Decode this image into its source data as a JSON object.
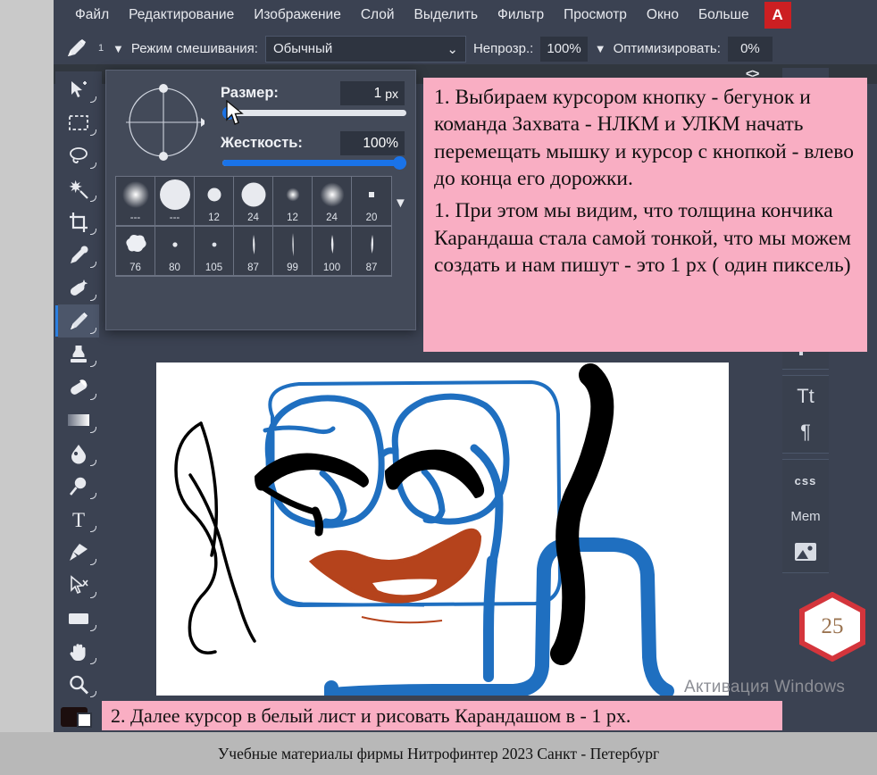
{
  "menubar": {
    "items": [
      {
        "label": "Файл"
      },
      {
        "label": "Редактирование"
      },
      {
        "label": "Изображение"
      },
      {
        "label": "Слой"
      },
      {
        "label": "Выделить"
      },
      {
        "label": "Фильтр"
      },
      {
        "label": "Просмотр"
      },
      {
        "label": "Окно"
      },
      {
        "label": "Больше"
      }
    ],
    "ai_badge": "A",
    "ai_badge_color": "#cc1f22"
  },
  "optionsbar": {
    "tool_icon": "pencil-icon",
    "preset_number": "1",
    "preset_dropdown": "▼",
    "blend_mode_label": "Режим смешивания:",
    "blend_mode_value": "Обычный",
    "blend_mode_chevron": "⌄",
    "opacity_label": "Непрозр.:",
    "opacity_value": "100%",
    "opacity_dropdown": "▼",
    "optimize_label": "Оптимизировать:",
    "optimize_value": "0%",
    "collapse_glyph": "<>"
  },
  "brush_panel": {
    "size_label": "Размер:",
    "size_value": "1",
    "size_unit": "px",
    "size_slider_percent": 0,
    "hardness_label": "Жесткость:",
    "hardness_value": "100%",
    "hardness_slider_percent": 100,
    "accent_color": "#1a73e8",
    "grid_row1": [
      {
        "label": "---",
        "kind": "soft",
        "size": 30
      },
      {
        "label": "---",
        "kind": "hard",
        "size": 34
      },
      {
        "label": "12",
        "kind": "hard",
        "size": 14
      },
      {
        "label": "24",
        "kind": "hard",
        "size": 26
      },
      {
        "label": "12",
        "kind": "soft",
        "size": 12
      },
      {
        "label": "24",
        "kind": "soft",
        "size": 24
      },
      {
        "label": "20",
        "kind": "square",
        "size": 6
      }
    ],
    "grid_row2": [
      {
        "label": "76",
        "kind": "blob",
        "size": 26
      },
      {
        "label": "80",
        "kind": "dot",
        "size": 5
      },
      {
        "label": "105",
        "kind": "dot",
        "size": 5
      },
      {
        "label": "87",
        "kind": "stroke",
        "size": 18
      },
      {
        "label": "99",
        "kind": "stroke-thin",
        "size": 22
      },
      {
        "label": "100",
        "kind": "stroke",
        "size": 20
      },
      {
        "label": "87",
        "kind": "stroke",
        "size": 19
      }
    ],
    "grid_more_arrow": "▼"
  },
  "toolbar": {
    "tools": [
      {
        "name": "move-tool",
        "icon": "cursor-plus-icon",
        "active": false
      },
      {
        "name": "rectangle-select-tool",
        "icon": "marquee-icon",
        "active": false
      },
      {
        "name": "lasso-tool",
        "icon": "lasso-icon",
        "active": false
      },
      {
        "name": "magic-wand-tool",
        "icon": "magic-wand-icon",
        "active": false
      },
      {
        "name": "crop-tool",
        "icon": "crop-icon",
        "active": false
      },
      {
        "name": "eyedropper-tool",
        "icon": "eyedropper-icon",
        "active": false
      },
      {
        "name": "healing-brush-tool",
        "icon": "bandage-sparkle-icon",
        "active": false
      },
      {
        "name": "pencil-tool",
        "icon": "pencil-icon",
        "active": true
      },
      {
        "name": "stamp-tool",
        "icon": "stamp-icon",
        "active": false
      },
      {
        "name": "eraser-tool",
        "icon": "eraser-icon",
        "active": false
      },
      {
        "name": "gradient-tool",
        "icon": "gradient-icon",
        "active": false
      },
      {
        "name": "blur-tool",
        "icon": "droplet-icon",
        "active": false
      },
      {
        "name": "dodge-tool",
        "icon": "dodge-icon",
        "active": false
      },
      {
        "name": "type-tool",
        "icon": "text-t-icon",
        "active": false
      },
      {
        "name": "pen-tool",
        "icon": "pen-nib-icon",
        "active": false
      },
      {
        "name": "path-select-tool",
        "icon": "path-arrow-icon",
        "active": false
      },
      {
        "name": "shape-tool",
        "icon": "rectangle-shape-icon",
        "active": false
      },
      {
        "name": "hand-tool",
        "icon": "hand-icon",
        "active": false
      },
      {
        "name": "zoom-tool",
        "icon": "magnifier-icon",
        "active": false
      }
    ],
    "foreground_color": "#1c0e0e",
    "background_color": "#ffffff"
  },
  "right_panel": {
    "groups": [
      {
        "items": [
          {
            "icon": "swatch-icon",
            "label": ""
          }
        ]
      },
      {
        "items": [
          {
            "icon": "character-icon",
            "label": "Tt"
          },
          {
            "icon": "paragraph-icon",
            "label": "¶"
          }
        ]
      },
      {
        "items": [
          {
            "icon": "css-icon",
            "label": "css"
          },
          {
            "icon": "memory-icon",
            "label": "Mem"
          },
          {
            "icon": "image-icon",
            "label": ""
          }
        ]
      },
      {
        "items": []
      }
    ]
  },
  "annotation_top": {
    "paragraph_1": "1. Выбираем курсором кнопку - бегунок и команда Захвата - НЛКМ и УЛКМ начать перемещать мышку и курсор с кнопкой - влево до конца его дорожки.",
    "paragraph_2": "1. При этом мы видим, что толщина кончика Карандаша стала самой тонкой, что мы можем создать и нам пишут - это 1 px ( один пиксель)",
    "background_color": "#f9aec3"
  },
  "annotation_bottom": {
    "text": "2. Далее курсор в белый лист и рисовать Карандашом в  - 1 px.",
    "background_color": "#f9aec3"
  },
  "watermark": {
    "text": "Активация Windows"
  },
  "page_badge": {
    "number": "25",
    "border_color": "#d4353c",
    "text_color": "#9a7350"
  },
  "footer": {
    "text": "Учебные материалы фирмы Нитрофинтер 2023 Санкт - Петербург"
  },
  "canvas": {
    "name": "drawing-canvas",
    "background": "#ffffff",
    "stroke_colors": {
      "blue": "#1f6fc0",
      "black": "#000000",
      "brown": "#b5431c"
    }
  }
}
